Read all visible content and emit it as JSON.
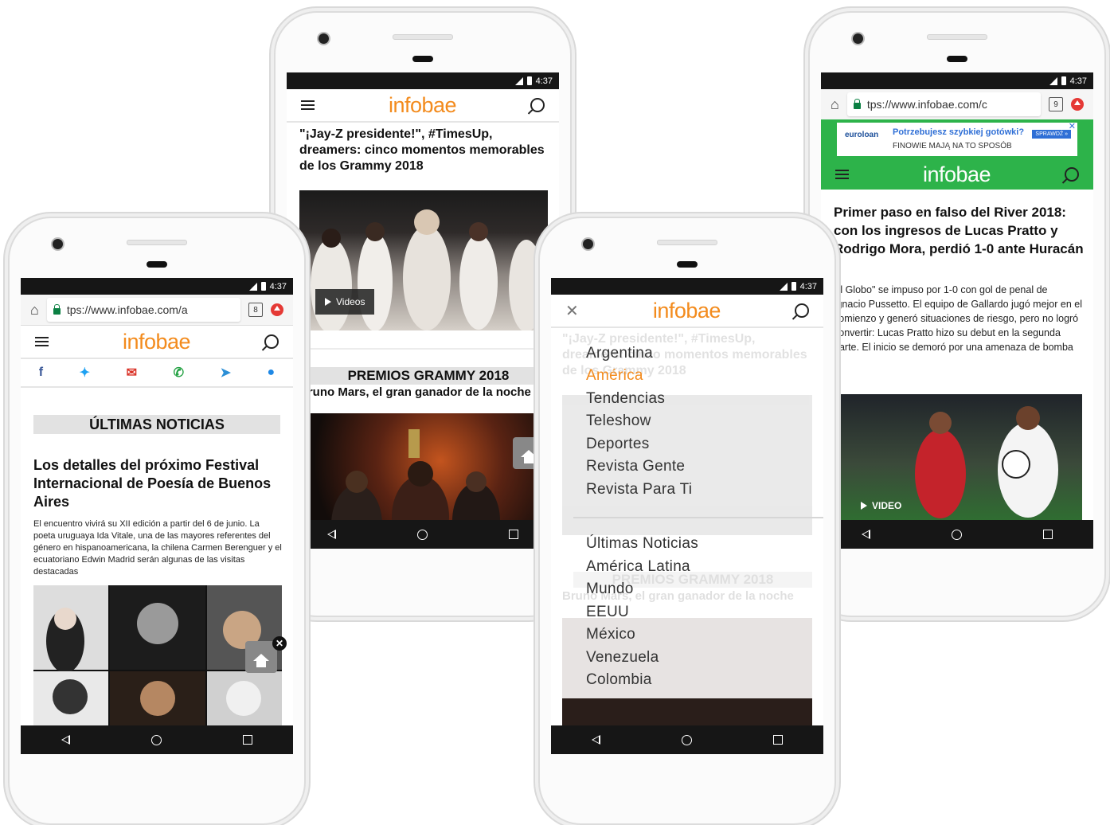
{
  "common": {
    "time": "4:37",
    "logo": "infobae",
    "url": "tps://www.infobae.com/",
    "url_short": "tps://www.infobae.com/a",
    "url_c": "tps://www.infobae.com/c"
  },
  "phone1": {
    "tab_count": "8",
    "section_title": "ÚLTIMAS NOTICIAS",
    "headline": "Los detalles del próximo Festival Internacional de Poesía de Buenos Aires",
    "body": "El encuentro vivirá su XII edición a partir del 6 de junio. La poeta uruguaya Ida Vitale, una de las mayores referentes del género en hispanoamericana, la chilena Carmen Berenguer y el ecuatoriano Edwin Madrid serán algunas de las visitas destacadas",
    "share_icons": [
      "facebook-icon",
      "twitter-icon",
      "mail-icon",
      "whatsapp-icon",
      "telegram-icon",
      "messenger-icon"
    ],
    "accent": "#f38b1d"
  },
  "phone2": {
    "headline": "\"¡Jay-Z presidente!\", #TimesUp, dreamers: cinco momentos memorables de los Grammy 2018",
    "video_label": "Videos",
    "section_title": "PREMIOS GRAMMY 2018",
    "subheadline": "Bruno Mars, el gran ganador de la noche"
  },
  "phone3": {
    "menu_primary": [
      "Argentina",
      "América",
      "Tendencias",
      "Teleshow",
      "Deportes",
      "Revista Gente",
      "Revista Para Ti"
    ],
    "active_item": "América",
    "menu_secondary": [
      "Últimas Noticias",
      "América Latina",
      "Mundo",
      "EEUU",
      "México",
      "Venezuela",
      "Colombia"
    ],
    "bg_headline": "\"¡Jay-Z presidente!\", #TimesUp, dreamers: cinco momentos memorables de los Grammy 2018",
    "bg_section": "PREMIOS GRAMMY 2018",
    "bg_sub": "Bruno Mars, el gran ganador de la noche"
  },
  "phone4": {
    "tab_count": "9",
    "ad_brand": "euroloan",
    "ad_line1": "Potrzebujesz szybkiej gotówki?",
    "ad_line2": "FINOWIE MAJĄ NA TO SPOSÓB",
    "ad_cta": "SPRAWDŹ »",
    "headline": "Primer paso en falso del River 2018: con los ingresos de Lucas Pratto y Rodrigo Mora, perdió 1-0 ante Huracán",
    "body": "El Globo\" se impuso por 1-0 con gol de penal de Ignacio Pussetto. El equipo de Gallardo jugó mejor en el comienzo y generó situaciones de riesgo, pero no logró convertir: Lucas Pratto hizo su debut en la segunda parte. El inicio se demoró por una amenaza de bomba",
    "video_label": "VIDEO",
    "header_color": "#2db34a"
  }
}
